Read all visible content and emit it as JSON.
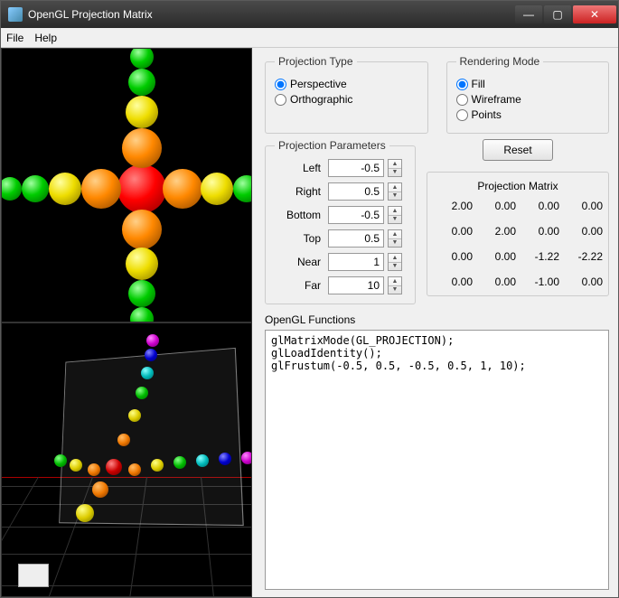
{
  "window": {
    "title": "OpenGL Projection Matrix"
  },
  "menu": {
    "file": "File",
    "help": "Help"
  },
  "projType": {
    "legend": "Projection Type",
    "perspective": "Perspective",
    "orthographic": "Orthographic",
    "selected": "perspective"
  },
  "renderMode": {
    "legend": "Rendering Mode",
    "fill": "Fill",
    "wireframe": "Wireframe",
    "points": "Points",
    "selected": "fill"
  },
  "params": {
    "legend": "Projection Parameters",
    "left_label": "Left",
    "left": "-0.5",
    "right_label": "Right",
    "right": "0.5",
    "bottom_label": "Bottom",
    "bottom": "-0.5",
    "top_label": "Top",
    "top": "0.5",
    "near_label": "Near",
    "near": "1",
    "far_label": "Far",
    "far": "10"
  },
  "reset": {
    "label": "Reset"
  },
  "matrix": {
    "title": "Projection Matrix",
    "cells": [
      "2.00",
      "0.00",
      "0.00",
      "0.00",
      "0.00",
      "2.00",
      "0.00",
      "0.00",
      "0.00",
      "0.00",
      "-1.22",
      "-2.22",
      "0.00",
      "0.00",
      "-1.00",
      "0.00"
    ]
  },
  "functions": {
    "label": "OpenGL Functions",
    "code": "glMatrixMode(GL_PROJECTION);\nglLoadIdentity();\nglFrustum(-0.5, 0.5, -0.5, 0.5, 1, 10);"
  }
}
